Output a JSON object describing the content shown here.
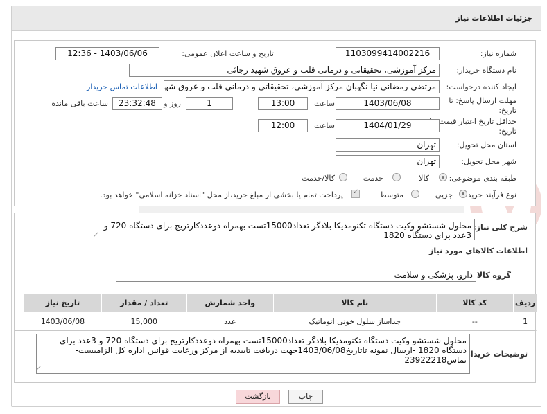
{
  "header": {
    "title": "جزئیات اطلاعات نیاز"
  },
  "fields": {
    "need_number_label": "شماره نیاز:",
    "need_number": "1103099414002216",
    "announce_label": "تاریخ و ساعت اعلان عمومی:",
    "announce_value": "1403/06/06 - 12:36",
    "buyer_label": "نام دستگاه خریدار:",
    "buyer_value": "مرکز آموزشی، تحقیقاتی و درمانی قلب و عروق شهید رجائی",
    "creator_label": "ایجاد کننده درخواست:",
    "creator_value": "مرتضی رمضانی نیا نگهبان مرکز آموزشی، تحقیقاتی و درمانی قلب و عروق شهید",
    "contact_link": "اطلاعات تماس خریدار",
    "deadline_label_1": "مهلت ارسال پاسخ: تا",
    "deadline_label_2": "تاریخ:",
    "deadline_date": "1403/06/08",
    "time_word": "ساعت",
    "deadline_time": "13:00",
    "days_value": "1",
    "days_word": "روز و",
    "remaining_time": "23:32:48",
    "remaining_word": "ساعت باقی مانده",
    "validity_label_1": "حداقل تاریخ اعتبار قیمت: تا",
    "validity_label_2": "تاریخ:",
    "validity_date": "1404/01/29",
    "validity_time": "12:00",
    "province_label": "استان محل تحویل:",
    "province_value": "تهران",
    "city_label": "شهر محل تحویل:",
    "city_value": "تهران",
    "category_label": "طبقه بندی موضوعی:",
    "category_options": [
      "کالا",
      "خدمت",
      "کالا/خدمت"
    ],
    "process_label": "نوع فرآیند خرید :",
    "process_options": [
      "جزیی",
      "متوسط"
    ],
    "payment_note": "پرداخت تمام یا بخشی از مبلغ خرید،از محل \"اسناد خزانه اسلامی\" خواهد بود."
  },
  "summary": {
    "label": "شرح کلی نیاز:",
    "text": "محلول شستشو وکیت دستگاه تکنومدیکا بلادگر تعداد15000تست  بهمراه دوعددکارتریج برای دستگاه 720 و 3عدد برای دستگاه 1820",
    "goods_info_title": "اطلاعات کالاهای مورد نیاز",
    "group_label": "گروه کالا:",
    "group_value": "دارو، پزشکی و سلامت"
  },
  "table": {
    "headers": [
      "ردیف",
      "کد کالا",
      "نام کالا",
      "واحد شمارش",
      "تعداد / مقدار",
      "تاریخ نیاز"
    ],
    "rows": [
      [
        "1",
        "--",
        "جداساز سلول خونی اتوماتیک",
        "عدد",
        "15,000",
        "1403/06/08"
      ]
    ]
  },
  "buyer_notes": {
    "label": "توضیحات خریدار:",
    "text": "محلول شستشو وکیت دستگاه تکنومدیکا بلادگر تعداد15000تست  بهمراه دوعددکارتریج برای دستگاه 720 و 3عدد برای دستگاه 1820 -ارسال نمونه تاتاریخ1403/06/08جهت دریافت تاییدیه از مرکز ورعایت قوانین اداره کل الزامیست-تماس23922218"
  },
  "buttons": {
    "print": "چاپ",
    "back": "بازگشت"
  },
  "colors": {
    "back_button_bg": "#f8d7da",
    "link": "#1a5fb4",
    "header_bg": "#e9e9e9"
  }
}
